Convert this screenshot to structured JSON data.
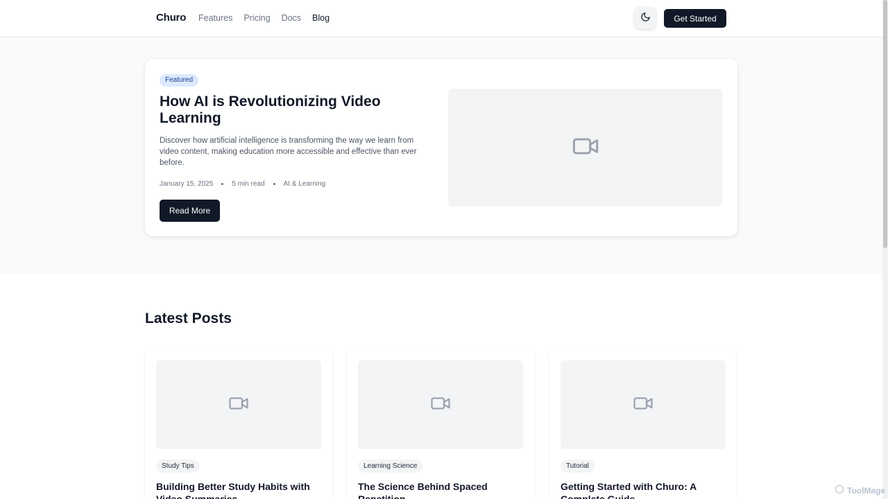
{
  "header": {
    "brand": "Churo",
    "nav": [
      "Features",
      "Pricing",
      "Docs",
      "Blog"
    ],
    "active_nav": "Blog",
    "theme_toggle_icon": "moon-icon",
    "cta_label": "Get Started"
  },
  "hero": {
    "badge": "Featured",
    "title": "How AI is Revolutionizing Video Learning",
    "description": "Discover how artificial intelligence is transforming the way we learn from video content, making education more accessible and effective than ever before.",
    "date": "January 15, 2025",
    "read_time": "5 min read",
    "category": "AI & Learning",
    "button_label": "Read More",
    "media_icon": "video-camera-icon"
  },
  "latest": {
    "title": "Latest Posts",
    "posts": [
      {
        "tag": "Study Tips",
        "title": "Building Better Study Habits with Video Summaries",
        "media_icon": "video-camera-icon"
      },
      {
        "tag": "Learning Science",
        "title": "The Science Behind Spaced Repetition",
        "media_icon": "video-camera-icon"
      },
      {
        "tag": "Tutorial",
        "title": "Getting Started with Churo: A Complete Guide",
        "media_icon": "video-camera-icon"
      }
    ]
  },
  "watermark": "ToolMage",
  "colors": {
    "primary": "#111827",
    "muted": "#6b7280",
    "hero_bg": "#f9fafb",
    "placeholder_bg": "#f3f4f6",
    "featured_badge_bg": "#dbeafe",
    "featured_badge_text": "#1e3a8a"
  }
}
